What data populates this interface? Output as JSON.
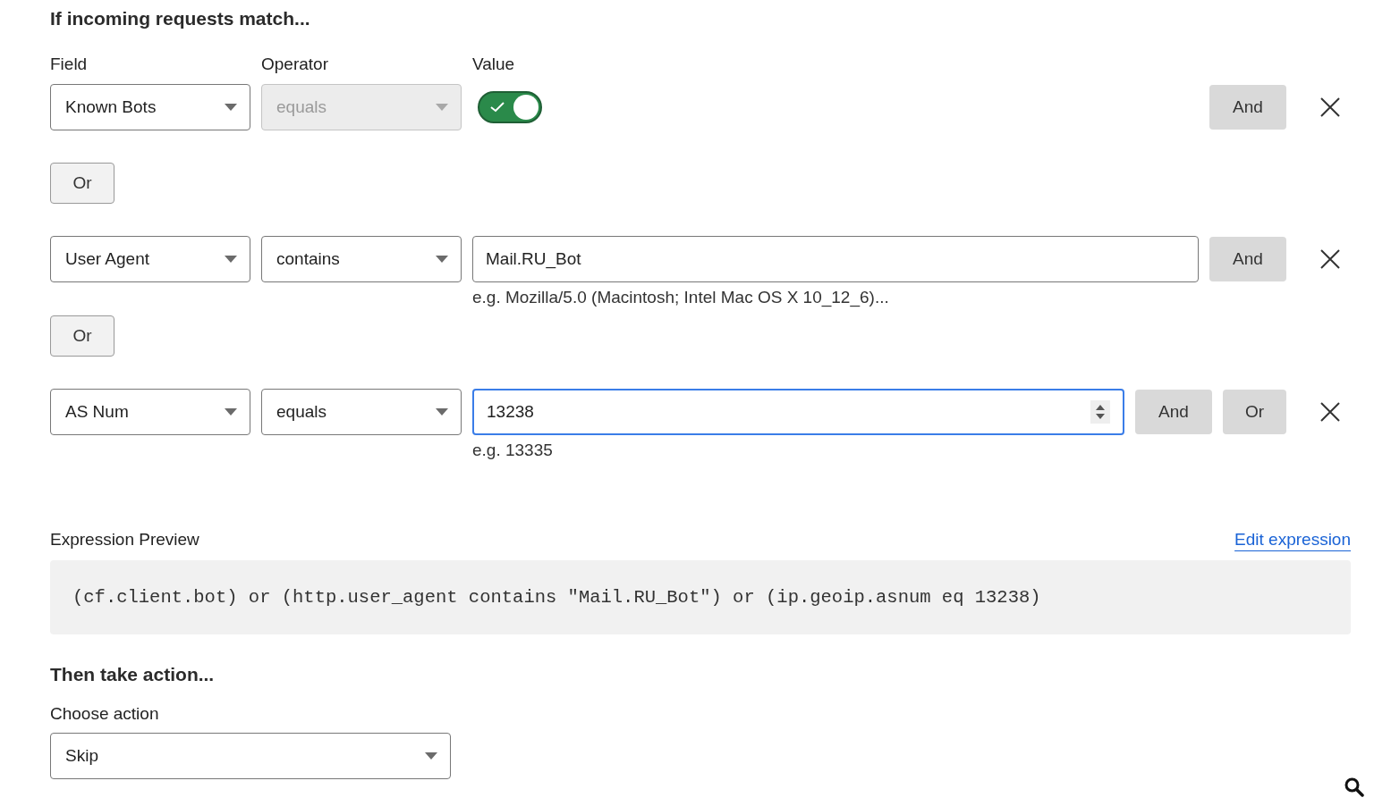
{
  "heading": "If incoming requests match...",
  "column_labels": [
    "Field",
    "Operator",
    "Value"
  ],
  "conditions": [
    {
      "field": "Known Bots",
      "operator": "equals",
      "operator_disabled": true,
      "kind": "toggle",
      "toggle_on": true,
      "buttons": [
        "And"
      ],
      "or_button": "Or"
    },
    {
      "field": "User Agent",
      "operator": "contains",
      "operator_disabled": false,
      "kind": "text",
      "value": "Mail.RU_Bot",
      "focused": false,
      "hint": "e.g. Mozilla/5.0 (Macintosh; Intel Mac OS X 10_12_6)...",
      "buttons": [
        "And"
      ],
      "or_button": "Or"
    },
    {
      "field": "AS Num",
      "operator": "equals",
      "operator_disabled": false,
      "kind": "number",
      "value": "13238",
      "focused": true,
      "hint": "e.g. 13335",
      "buttons": [
        "And",
        "Or"
      ]
    }
  ],
  "expression_preview": {
    "label": "Expression Preview",
    "edit_link": "Edit expression",
    "code": "(cf.client.bot) or (http.user_agent contains \"Mail.RU_Bot\") or (ip.geoip.asnum eq 13238)"
  },
  "action": {
    "heading": "Then take action...",
    "label": "Choose action",
    "value": "Skip"
  }
}
